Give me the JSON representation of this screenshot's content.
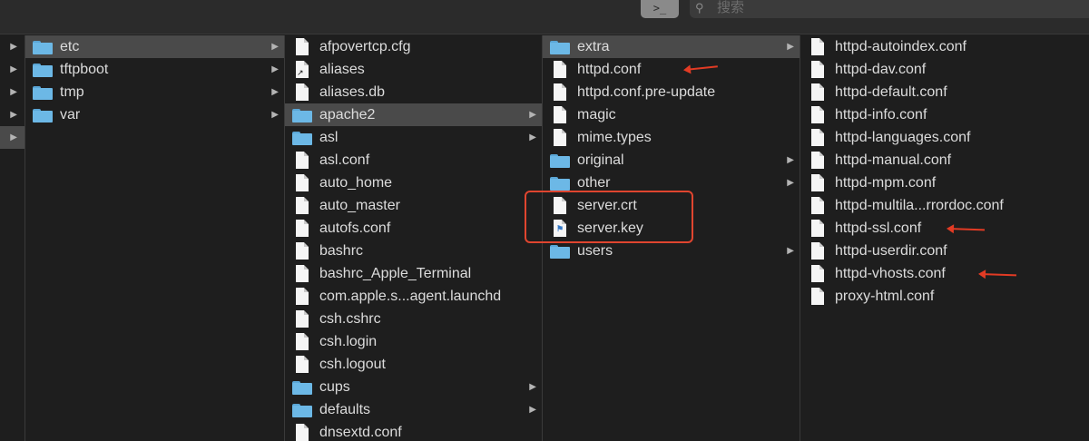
{
  "toolbar": {
    "terminal_button_label": ">_",
    "search_placeholder": "搜索",
    "search_icon": "magnifier-icon"
  },
  "columns": {
    "col0": [
      {
        "has_chevron": true
      },
      {
        "has_chevron": true
      },
      {
        "has_chevron": true
      },
      {
        "has_chevron": true
      },
      {
        "has_chevron": true,
        "selected": true
      }
    ],
    "col1": [
      {
        "name": "etc",
        "kind": "folder",
        "selected": true,
        "has_chevron": true
      },
      {
        "name": "tftpboot",
        "kind": "folder",
        "has_chevron": true
      },
      {
        "name": "tmp",
        "kind": "folder",
        "has_chevron": true
      },
      {
        "name": "var",
        "kind": "folder",
        "has_chevron": true
      }
    ],
    "col2": [
      {
        "name": "afpovertcp.cfg",
        "kind": "file"
      },
      {
        "name": "aliases",
        "kind": "alias"
      },
      {
        "name": "aliases.db",
        "kind": "file"
      },
      {
        "name": "apache2",
        "kind": "folder",
        "selected": true,
        "has_chevron": true
      },
      {
        "name": "asl",
        "kind": "folder",
        "has_chevron": true
      },
      {
        "name": "asl.conf",
        "kind": "file"
      },
      {
        "name": "auto_home",
        "kind": "file"
      },
      {
        "name": "auto_master",
        "kind": "file"
      },
      {
        "name": "autofs.conf",
        "kind": "file"
      },
      {
        "name": "bashrc",
        "kind": "file"
      },
      {
        "name": "bashrc_Apple_Terminal",
        "kind": "file"
      },
      {
        "name": "com.apple.s...agent.launchd",
        "kind": "file"
      },
      {
        "name": "csh.cshrc",
        "kind": "file"
      },
      {
        "name": "csh.login",
        "kind": "file"
      },
      {
        "name": "csh.logout",
        "kind": "file"
      },
      {
        "name": "cups",
        "kind": "folder",
        "has_chevron": true
      },
      {
        "name": "defaults",
        "kind": "folder",
        "has_chevron": true
      },
      {
        "name": "dnsextd.conf",
        "kind": "file"
      }
    ],
    "col3": [
      {
        "name": "extra",
        "kind": "folder",
        "selected": true,
        "has_chevron": true
      },
      {
        "name": "httpd.conf",
        "kind": "file"
      },
      {
        "name": "httpd.conf.pre-update",
        "kind": "file"
      },
      {
        "name": "magic",
        "kind": "file"
      },
      {
        "name": "mime.types",
        "kind": "file"
      },
      {
        "name": "original",
        "kind": "folder",
        "has_chevron": true
      },
      {
        "name": "other",
        "kind": "folder",
        "has_chevron": true
      },
      {
        "name": "server.crt",
        "kind": "file"
      },
      {
        "name": "server.key",
        "kind": "cert"
      },
      {
        "name": "users",
        "kind": "folder",
        "has_chevron": true
      }
    ],
    "col4": [
      {
        "name": "httpd-autoindex.conf",
        "kind": "file"
      },
      {
        "name": "httpd-dav.conf",
        "kind": "file"
      },
      {
        "name": "httpd-default.conf",
        "kind": "file"
      },
      {
        "name": "httpd-info.conf",
        "kind": "file"
      },
      {
        "name": "httpd-languages.conf",
        "kind": "file"
      },
      {
        "name": "httpd-manual.conf",
        "kind": "file"
      },
      {
        "name": "httpd-mpm.conf",
        "kind": "file"
      },
      {
        "name": "httpd-multila...rrordoc.conf",
        "kind": "file"
      },
      {
        "name": "httpd-ssl.conf",
        "kind": "file"
      },
      {
        "name": "httpd-userdir.conf",
        "kind": "file"
      },
      {
        "name": "httpd-vhosts.conf",
        "kind": "file"
      },
      {
        "name": "proxy-html.conf",
        "kind": "file"
      }
    ]
  },
  "annotation_color": "#e23b24",
  "arrows": [
    {
      "col": "col3",
      "row": 1,
      "target": "httpd.conf"
    },
    {
      "col": "col4",
      "row": 8,
      "target": "httpd-ssl.conf"
    },
    {
      "col": "col4",
      "row": 10,
      "target": "httpd-vhosts.conf"
    }
  ],
  "highlight": {
    "col": "col3",
    "rows": [
      7,
      8
    ],
    "targets": [
      "server.crt",
      "server.key"
    ]
  }
}
